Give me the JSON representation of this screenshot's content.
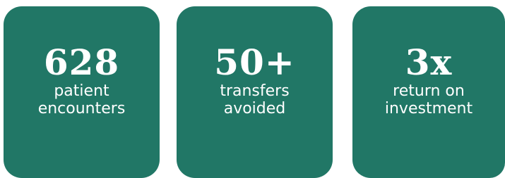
{
  "stats": [
    {
      "value": "628",
      "label_line1": "patient",
      "label_line2": "encounters"
    },
    {
      "value": "50+",
      "label_line1": "transfers",
      "label_line2": "avoided"
    },
    {
      "value": "3x",
      "label_line1": "return on",
      "label_line2": "investment"
    }
  ],
  "colors": {
    "card_background": "#217766",
    "text": "#ffffff",
    "page_background": "#ffffff"
  }
}
